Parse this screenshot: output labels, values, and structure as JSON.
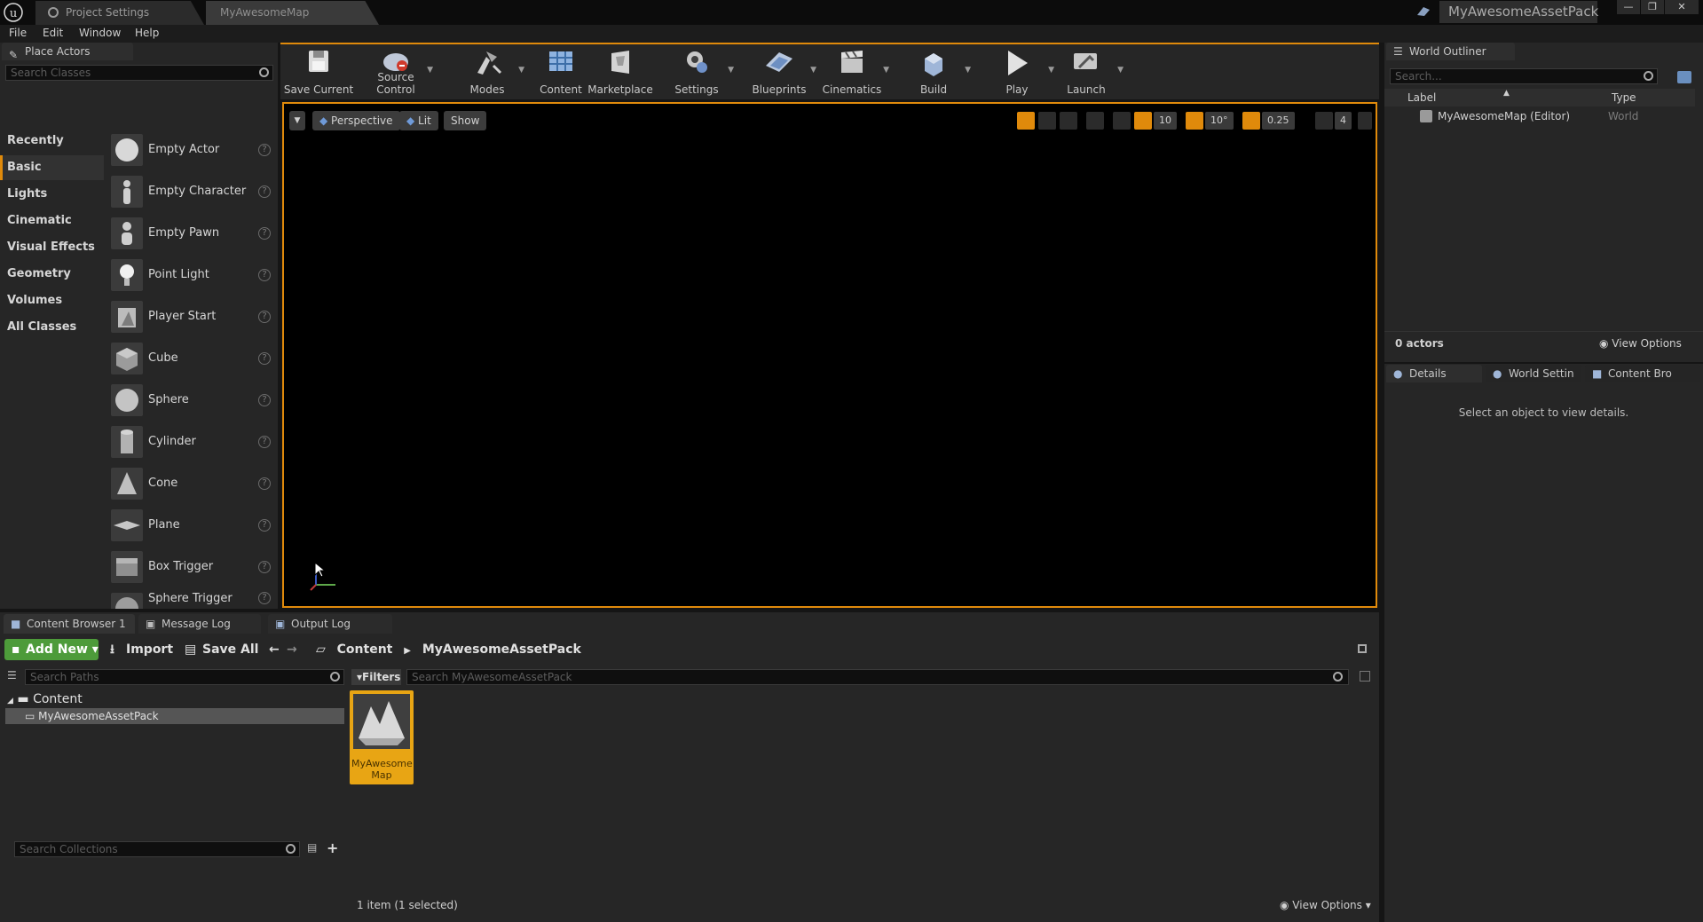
{
  "titlebar": {
    "tabs": [
      {
        "label": "Project Settings"
      },
      {
        "label": "MyAwesomeMap"
      }
    ],
    "project_name": "MyAwesomeAssetPack",
    "window_buttons": [
      "—",
      "❐",
      "✕"
    ]
  },
  "menu": {
    "items": [
      "File",
      "Edit",
      "Window",
      "Help"
    ]
  },
  "place_actors": {
    "tab_label": "Place Actors",
    "search_placeholder": "Search Classes",
    "categories": [
      "Recently Placed",
      "Basic",
      "Lights",
      "Cinematic",
      "Visual Effects",
      "Geometry",
      "Volumes",
      "All Classes"
    ],
    "active_category": "Basic",
    "actors": [
      {
        "label": "Empty Actor",
        "icon": "sphere-icon"
      },
      {
        "label": "Empty Character",
        "icon": "character-icon"
      },
      {
        "label": "Empty Pawn",
        "icon": "pawn-icon"
      },
      {
        "label": "Point Light",
        "icon": "light-bulb-icon"
      },
      {
        "label": "Player Start",
        "icon": "player-start-icon"
      },
      {
        "label": "Cube",
        "icon": "cube-icon"
      },
      {
        "label": "Sphere",
        "icon": "sphere-icon"
      },
      {
        "label": "Cylinder",
        "icon": "cylinder-icon"
      },
      {
        "label": "Cone",
        "icon": "cone-icon"
      },
      {
        "label": "Plane",
        "icon": "plane-icon"
      },
      {
        "label": "Box Trigger",
        "icon": "box-trigger-icon"
      },
      {
        "label": "Sphere Trigger",
        "icon": "sphere-trigger-icon"
      }
    ]
  },
  "toolbar": {
    "buttons": [
      {
        "label": "Save Current",
        "icon": "save-icon",
        "dropdown": false
      },
      {
        "label": "Source Control",
        "icon": "source-control-icon",
        "dropdown": true
      },
      {
        "label": "Modes",
        "icon": "modes-icon",
        "dropdown": true
      },
      {
        "label": "Content",
        "icon": "content-icon",
        "dropdown": false
      },
      {
        "label": "Marketplace",
        "icon": "marketplace-icon",
        "dropdown": false
      },
      {
        "label": "Settings",
        "icon": "settings-icon",
        "dropdown": true
      },
      {
        "label": "Blueprints",
        "icon": "blueprints-icon",
        "dropdown": true
      },
      {
        "label": "Cinematics",
        "icon": "cinematics-icon",
        "dropdown": true
      },
      {
        "label": "Build",
        "icon": "build-icon",
        "dropdown": true
      },
      {
        "label": "Play",
        "icon": "play-icon",
        "dropdown": true
      },
      {
        "label": "Launch",
        "icon": "launch-icon",
        "dropdown": true
      }
    ]
  },
  "viewport": {
    "perspective_label": "Perspective",
    "lit_label": "Lit",
    "show_label": "Show",
    "grid_snap": "10",
    "rotation_snap": "10°",
    "scale_snap": "0.25",
    "camera_speed": "4"
  },
  "world_outliner": {
    "tab_label": "World Outliner",
    "search_placeholder": "Search...",
    "col_label": "Label",
    "col_type": "Type",
    "rows": [
      {
        "label": "MyAwesomeMap (Editor)",
        "type": "World"
      }
    ],
    "actor_count": "0 actors",
    "view_options": "View Options"
  },
  "details": {
    "tabs": [
      "Details",
      "World Settin",
      "Content Bro"
    ],
    "empty_message": "Select an object to view details."
  },
  "content_browser": {
    "tabs": [
      "Content Browser 1",
      "Message Log",
      "Output Log"
    ],
    "add_new": "Add New",
    "import": "Import",
    "save_all": "Save All",
    "breadcrumb": [
      "Content",
      "MyAwesomeAssetPack"
    ],
    "search_paths_placeholder": "Search Paths",
    "tree": {
      "root": "Content",
      "child": "MyAwesomeAssetPack"
    },
    "filters_label": "Filters",
    "search_assets_placeholder": "Search MyAwesomeAssetPack",
    "assets": [
      {
        "label": "MyAwesome Map",
        "icon": "map-icon"
      }
    ],
    "search_collections_placeholder": "Search Collections",
    "status": "1 item (1 selected)",
    "view_options": "View Options"
  }
}
